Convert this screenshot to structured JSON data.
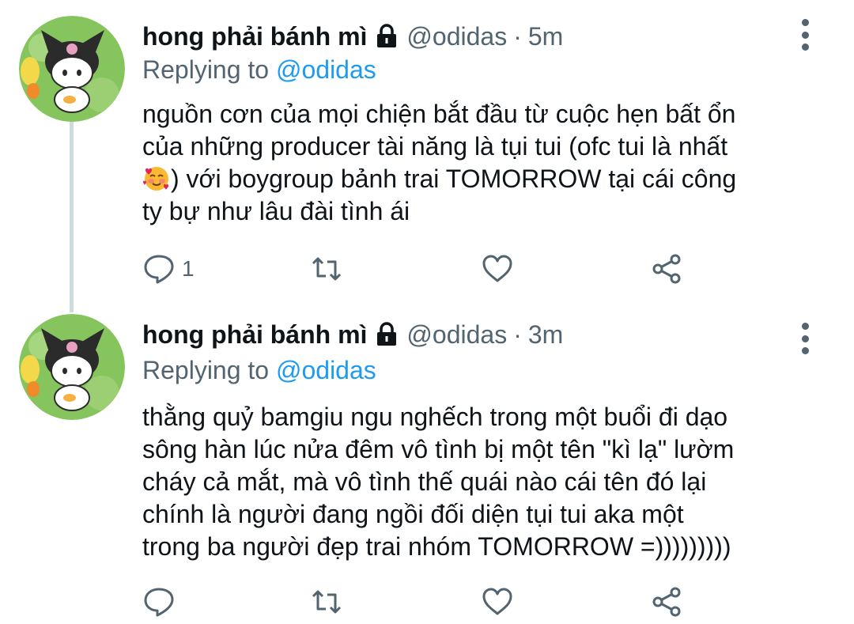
{
  "colors": {
    "link": "#1d9bf0",
    "secondary_text": "#536471",
    "thread_line": "#cfd9de",
    "avatar_bg": "#7fc25b"
  },
  "tweets": [
    {
      "display_name": "hong phải bánh mì",
      "handle": "@odidas",
      "separator": "·",
      "time": "5m",
      "replying_prefix": "Replying to ",
      "replying_to": "@odidas",
      "text_before_emoji": "nguồn cơn của mọi chiện bắt đầu từ cuộc hẹn bất ổn\ncủa những producer tài năng là tụi tui (ofc tui là nhất\n",
      "emoji": "smiling-face-with-hearts",
      "text_after_emoji": ") với boygroup bảnh trai TOMORROW tại cái công\nty bự như lâu đài tình ái",
      "reply_count": "1",
      "icons": [
        "reply-icon",
        "retweet-icon",
        "like-icon",
        "share-icon",
        "more-icon",
        "lock-icon"
      ]
    },
    {
      "display_name": "hong phải bánh mì",
      "handle": "@odidas",
      "separator": "·",
      "time": "3m",
      "replying_prefix": "Replying to ",
      "replying_to": "@odidas",
      "text": "thằng quỷ bamgiu ngu nghếch trong một buổi đi dạo\nsông hàn lúc nửa đêm vô tình bị một tên \"kì lạ\" lườm\ncháy cả mắt, mà vô tình thế quái nào cái tên đó lại\nchính là người đang ngồi đối diện tụi tui aka một\ntrong ba người đẹp trai nhóm TOMORROW =)))))))))",
      "reply_count": "",
      "icons": [
        "reply-icon",
        "retweet-icon",
        "like-icon",
        "share-icon",
        "more-icon",
        "lock-icon"
      ]
    }
  ]
}
